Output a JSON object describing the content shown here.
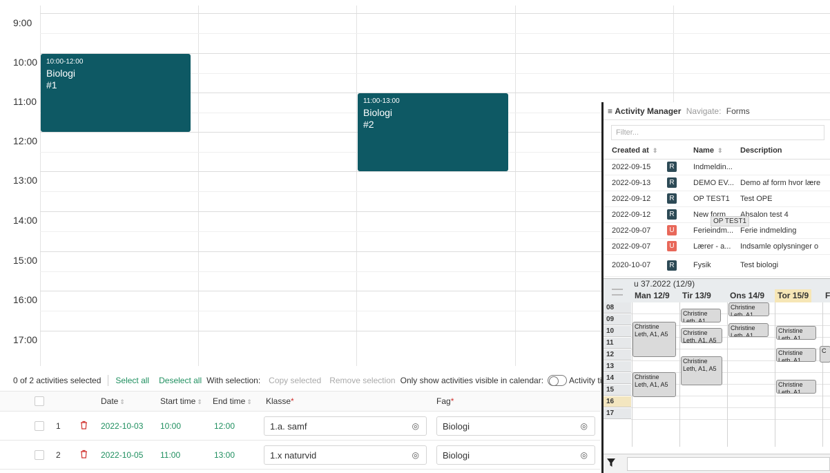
{
  "calendar": {
    "hours": [
      "9:00",
      "10:00",
      "11:00",
      "12:00",
      "13:00",
      "14:00",
      "15:00",
      "16:00",
      "17:00"
    ],
    "events": [
      {
        "time": "10:00-12:00",
        "title": "Biologi",
        "num": "#1"
      },
      {
        "time": "11:00-13:00",
        "title": "Biologi",
        "num": "#2"
      }
    ]
  },
  "toolbar": {
    "selected_count": "0 of 2 activities selected",
    "select_all": "Select all",
    "deselect_all": "Deselect all",
    "with_selection": "With selection:",
    "copy_selected": "Copy selected",
    "remove_selection": "Remove selection",
    "only_show": "Only show activities visible in calendar:",
    "activity_title": "Activity title:"
  },
  "table": {
    "headers": {
      "date": "Date",
      "start": "Start time",
      "end": "End time",
      "klasse": "Klasse",
      "fag": "Fag"
    },
    "rows": [
      {
        "idx": "1",
        "date": "2022-10-03",
        "start": "10:00",
        "end": "12:00",
        "klasse": "1.a. samf",
        "fag": "Biologi"
      },
      {
        "idx": "2",
        "date": "2022-10-05",
        "start": "11:00",
        "end": "13:00",
        "klasse": "1.x naturvid",
        "fag": "Biologi"
      }
    ]
  },
  "activity_manager": {
    "title": "Activity Manager",
    "navigate": "Navigate:",
    "forms": "Forms",
    "filter_placeholder": "Filter...",
    "headers": {
      "created": "Created at",
      "name": "Name",
      "description": "Description"
    },
    "rows": [
      {
        "created": "2022-09-15",
        "badge": "R",
        "name": "Indmeldin...",
        "desc": ""
      },
      {
        "created": "2022-09-13",
        "badge": "R",
        "name": "DEMO EV...",
        "desc": "Demo af form hvor lære"
      },
      {
        "created": "2022-09-12",
        "badge": "R",
        "name": "OP TEST1",
        "desc": "Test OPE"
      },
      {
        "created": "2022-09-12",
        "badge": "R",
        "name": "New form",
        "desc": "Absalon test 4"
      },
      {
        "created": "2022-09-07",
        "badge": "U",
        "name": "Ferieindm...",
        "desc": "Ferie indmelding"
      },
      {
        "created": "2022-09-07",
        "badge": "U",
        "name": "Lærer - a...",
        "desc": "Indsamle oplysninger o"
      },
      {
        "created": "2020-10-07",
        "badge": "R",
        "name": "Fysik",
        "desc": "Test biologi"
      }
    ],
    "tooltip": "OP TEST1",
    "week": {
      "label": "u 37.2022 (12/9)",
      "days": [
        "Man 12/9",
        "Tir 13/9",
        "Ons 14/9",
        "Tor 15/9",
        "F"
      ],
      "hours": [
        "08",
        "09",
        "10",
        "11",
        "12",
        "13",
        "14",
        "15",
        "16",
        "17"
      ],
      "blocks": [
        {
          "text": "Christine Leth, A1"
        },
        {
          "text": "Christine Leth, A1, A5"
        },
        {
          "text": "Christine Leth, A1"
        },
        {
          "text": "Christine Leth, A1, A5"
        },
        {
          "text": "Christine Leth, A1, A5"
        },
        {
          "text": "Christine Leth, A1"
        },
        {
          "text": "Christine Leth, A1"
        },
        {
          "text": "Christine Leth, A1"
        },
        {
          "text": "Christine Leth, A1, A5"
        },
        {
          "text": "Christine Leth, A1"
        },
        {
          "text": "C"
        }
      ]
    }
  },
  "colors": {
    "event": "#0e5964",
    "link": "#1f8f5f",
    "badge_r": "#2d4a56",
    "badge_u": "#e8685a"
  }
}
